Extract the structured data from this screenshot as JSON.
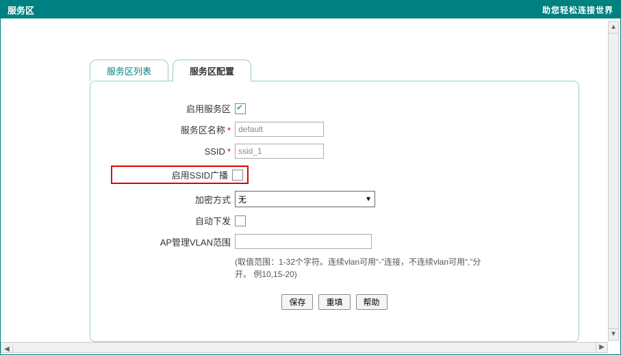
{
  "header": {
    "title": "服务区",
    "slogan": "助您轻松连接世界"
  },
  "tabs": {
    "list_label": "服务区列表",
    "config_label": "服务区配置"
  },
  "form": {
    "enable_zone_label": "启用服务区",
    "zone_name_label": "服务区名称",
    "zone_name_value": "default",
    "ssid_label": "SSID",
    "ssid_value": "ssid_1",
    "enable_ssid_broadcast_label": "启用SSID广播",
    "encryption_label": "加密方式",
    "encryption_value": "无",
    "auto_push_label": "自动下发",
    "ap_vlan_label": "AP管理VLAN范围",
    "ap_vlan_value": "",
    "hint": "(取值范围：1-32个字符。连续vlan可用“-”连接，不连续vlan可用“,”分开。 例10,15-20)"
  },
  "buttons": {
    "save": "保存",
    "refill": "重填",
    "help": "帮助"
  }
}
